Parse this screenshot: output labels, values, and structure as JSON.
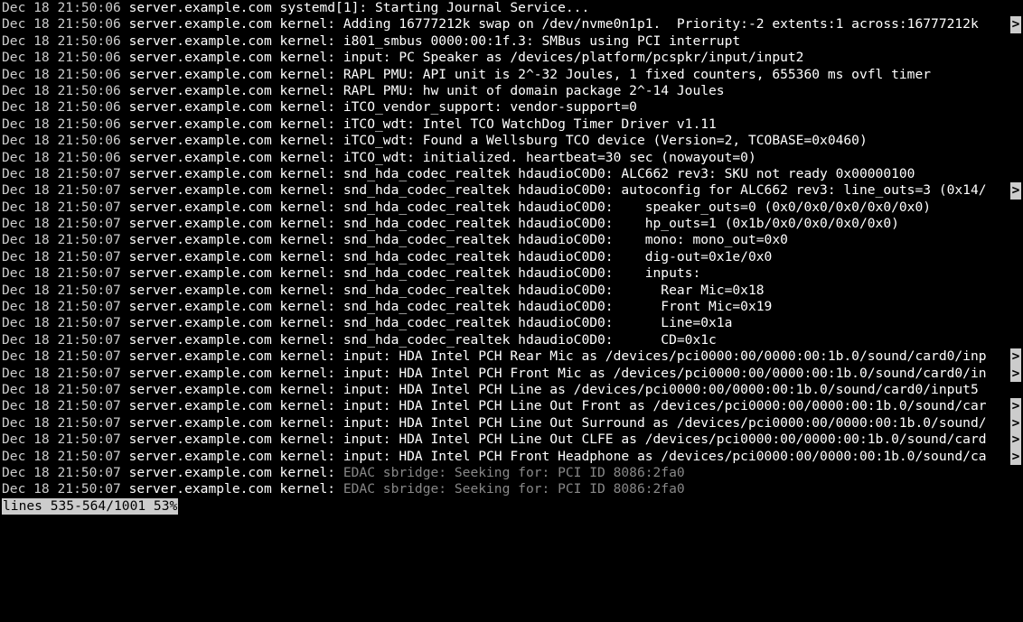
{
  "overflow_glyph": ">",
  "log_lines": [
    {
      "ts": "Dec 18 21:50:06",
      "host": "server.example.com",
      "src": "systemd[1]:",
      "msg": "Starting Journal Service...",
      "dim": false,
      "overflow": false
    },
    {
      "ts": "Dec 18 21:50:06",
      "host": "server.example.com",
      "src": "kernel:",
      "msg": "Adding 16777212k swap on /dev/nvme0n1p1.  Priority:-2 extents:1 across:16777212k ",
      "dim": false,
      "overflow": true
    },
    {
      "ts": "Dec 18 21:50:06",
      "host": "server.example.com",
      "src": "kernel:",
      "msg": "i801_smbus 0000:00:1f.3: SMBus using PCI interrupt",
      "dim": false,
      "overflow": false
    },
    {
      "ts": "Dec 18 21:50:06",
      "host": "server.example.com",
      "src": "kernel:",
      "msg": "input: PC Speaker as /devices/platform/pcspkr/input/input2",
      "dim": false,
      "overflow": false
    },
    {
      "ts": "Dec 18 21:50:06",
      "host": "server.example.com",
      "src": "kernel:",
      "msg": "RAPL PMU: API unit is 2^-32 Joules, 1 fixed counters, 655360 ms ovfl timer",
      "dim": false,
      "overflow": false
    },
    {
      "ts": "Dec 18 21:50:06",
      "host": "server.example.com",
      "src": "kernel:",
      "msg": "RAPL PMU: hw unit of domain package 2^-14 Joules",
      "dim": false,
      "overflow": false
    },
    {
      "ts": "Dec 18 21:50:06",
      "host": "server.example.com",
      "src": "kernel:",
      "msg": "iTCO_vendor_support: vendor-support=0",
      "dim": false,
      "overflow": false
    },
    {
      "ts": "Dec 18 21:50:06",
      "host": "server.example.com",
      "src": "kernel:",
      "msg": "iTCO_wdt: Intel TCO WatchDog Timer Driver v1.11",
      "dim": false,
      "overflow": false
    },
    {
      "ts": "Dec 18 21:50:06",
      "host": "server.example.com",
      "src": "kernel:",
      "msg": "iTCO_wdt: Found a Wellsburg TCO device (Version=2, TCOBASE=0x0460)",
      "dim": false,
      "overflow": false
    },
    {
      "ts": "Dec 18 21:50:06",
      "host": "server.example.com",
      "src": "kernel:",
      "msg": "iTCO_wdt: initialized. heartbeat=30 sec (nowayout=0)",
      "dim": false,
      "overflow": false
    },
    {
      "ts": "Dec 18 21:50:07",
      "host": "server.example.com",
      "src": "kernel:",
      "msg": "snd_hda_codec_realtek hdaudioC0D0: ALC662 rev3: SKU not ready 0x00000100",
      "dim": false,
      "overflow": false
    },
    {
      "ts": "Dec 18 21:50:07",
      "host": "server.example.com",
      "src": "kernel:",
      "msg": "snd_hda_codec_realtek hdaudioC0D0: autoconfig for ALC662 rev3: line_outs=3 (0x14/",
      "dim": false,
      "overflow": true
    },
    {
      "ts": "Dec 18 21:50:07",
      "host": "server.example.com",
      "src": "kernel:",
      "msg": "snd_hda_codec_realtek hdaudioC0D0:    speaker_outs=0 (0x0/0x0/0x0/0x0/0x0)",
      "dim": false,
      "overflow": false
    },
    {
      "ts": "Dec 18 21:50:07",
      "host": "server.example.com",
      "src": "kernel:",
      "msg": "snd_hda_codec_realtek hdaudioC0D0:    hp_outs=1 (0x1b/0x0/0x0/0x0/0x0)",
      "dim": false,
      "overflow": false
    },
    {
      "ts": "Dec 18 21:50:07",
      "host": "server.example.com",
      "src": "kernel:",
      "msg": "snd_hda_codec_realtek hdaudioC0D0:    mono: mono_out=0x0",
      "dim": false,
      "overflow": false
    },
    {
      "ts": "Dec 18 21:50:07",
      "host": "server.example.com",
      "src": "kernel:",
      "msg": "snd_hda_codec_realtek hdaudioC0D0:    dig-out=0x1e/0x0",
      "dim": false,
      "overflow": false
    },
    {
      "ts": "Dec 18 21:50:07",
      "host": "server.example.com",
      "src": "kernel:",
      "msg": "snd_hda_codec_realtek hdaudioC0D0:    inputs:",
      "dim": false,
      "overflow": false
    },
    {
      "ts": "Dec 18 21:50:07",
      "host": "server.example.com",
      "src": "kernel:",
      "msg": "snd_hda_codec_realtek hdaudioC0D0:      Rear Mic=0x18",
      "dim": false,
      "overflow": false
    },
    {
      "ts": "Dec 18 21:50:07",
      "host": "server.example.com",
      "src": "kernel:",
      "msg": "snd_hda_codec_realtek hdaudioC0D0:      Front Mic=0x19",
      "dim": false,
      "overflow": false
    },
    {
      "ts": "Dec 18 21:50:07",
      "host": "server.example.com",
      "src": "kernel:",
      "msg": "snd_hda_codec_realtek hdaudioC0D0:      Line=0x1a",
      "dim": false,
      "overflow": false
    },
    {
      "ts": "Dec 18 21:50:07",
      "host": "server.example.com",
      "src": "kernel:",
      "msg": "snd_hda_codec_realtek hdaudioC0D0:      CD=0x1c",
      "dim": false,
      "overflow": false
    },
    {
      "ts": "Dec 18 21:50:07",
      "host": "server.example.com",
      "src": "kernel:",
      "msg": "input: HDA Intel PCH Rear Mic as /devices/pci0000:00/0000:00:1b.0/sound/card0/inp",
      "dim": false,
      "overflow": true
    },
    {
      "ts": "Dec 18 21:50:07",
      "host": "server.example.com",
      "src": "kernel:",
      "msg": "input: HDA Intel PCH Front Mic as /devices/pci0000:00/0000:00:1b.0/sound/card0/in",
      "dim": false,
      "overflow": true
    },
    {
      "ts": "Dec 18 21:50:07",
      "host": "server.example.com",
      "src": "kernel:",
      "msg": "input: HDA Intel PCH Line as /devices/pci0000:00/0000:00:1b.0/sound/card0/input5",
      "dim": false,
      "overflow": false
    },
    {
      "ts": "Dec 18 21:50:07",
      "host": "server.example.com",
      "src": "kernel:",
      "msg": "input: HDA Intel PCH Line Out Front as /devices/pci0000:00/0000:00:1b.0/sound/car",
      "dim": false,
      "overflow": true
    },
    {
      "ts": "Dec 18 21:50:07",
      "host": "server.example.com",
      "src": "kernel:",
      "msg": "input: HDA Intel PCH Line Out Surround as /devices/pci0000:00/0000:00:1b.0/sound/",
      "dim": false,
      "overflow": true
    },
    {
      "ts": "Dec 18 21:50:07",
      "host": "server.example.com",
      "src": "kernel:",
      "msg": "input: HDA Intel PCH Line Out CLFE as /devices/pci0000:00/0000:00:1b.0/sound/card",
      "dim": false,
      "overflow": true
    },
    {
      "ts": "Dec 18 21:50:07",
      "host": "server.example.com",
      "src": "kernel:",
      "msg": "input: HDA Intel PCH Front Headphone as /devices/pci0000:00/0000:00:1b.0/sound/ca",
      "dim": false,
      "overflow": true
    },
    {
      "ts": "Dec 18 21:50:07",
      "host": "server.example.com",
      "src": "kernel:",
      "msg": "EDAC sbridge: Seeking for: PCI ID 8086:2fa0",
      "dim": true,
      "overflow": false
    },
    {
      "ts": "Dec 18 21:50:07",
      "host": "server.example.com",
      "src": "kernel:",
      "msg": "EDAC sbridge: Seeking for: PCI ID 8086:2fa0",
      "dim": true,
      "overflow": false
    }
  ],
  "status_line": "lines 535-564/1001 53%"
}
